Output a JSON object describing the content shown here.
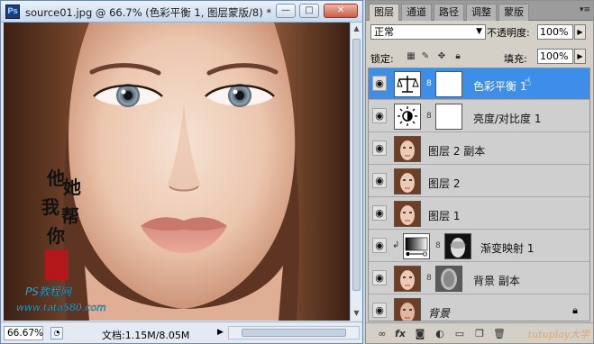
{
  "document": {
    "ps_logo": "Ps",
    "title": "source01.jpg @ 66.7% (色彩平衡 1, 图层蒙版/8) *",
    "buttons": {
      "minimize": "—",
      "restore": "□",
      "close": "✕"
    },
    "status": {
      "zoom": "66.67%",
      "info": "文档:1.15M/8.05M",
      "arrow": "▶"
    },
    "canvas_text": {
      "calligraphy": [
        "他",
        "她",
        "我",
        "帮",
        "你"
      ],
      "site_line1": "PS教程网",
      "site_line2": "www.tata580.com"
    }
  },
  "panel": {
    "tabs": [
      "图层",
      "通道",
      "路径",
      "调整",
      "蒙版"
    ],
    "active_tab": "图层",
    "menu_icon": "▾≡",
    "blend_mode": "正常",
    "opacity_label": "不透明度:",
    "opacity_value": "100%",
    "lock_label": "锁定:",
    "fill_label": "填充:",
    "fill_value": "100%",
    "lock_icons": [
      "transparent-pixels-lock-icon",
      "brush-lock-icon",
      "move-lock-icon",
      "all-lock-icon"
    ],
    "layers": [
      {
        "name": "色彩平衡 1",
        "type": "adjustment-color-balance",
        "selected": true,
        "visible": true
      },
      {
        "name": "亮度/对比度 1",
        "type": "adjustment-brightness",
        "selected": false,
        "visible": true
      },
      {
        "name": "图层 2 副本",
        "type": "pixel",
        "selected": false,
        "visible": true
      },
      {
        "name": "图层 2",
        "type": "pixel",
        "selected": false,
        "visible": true
      },
      {
        "name": "图层 1",
        "type": "pixel",
        "selected": false,
        "visible": true
      },
      {
        "name": "渐变映射 1",
        "type": "adjustment-gradient-map",
        "selected": false,
        "visible": true,
        "clipped": true
      },
      {
        "name": "背景 副本",
        "type": "pixel-masked",
        "selected": false,
        "visible": true
      },
      {
        "name": "背景",
        "type": "background",
        "selected": false,
        "visible": true,
        "locked": true
      }
    ],
    "bottom_icons": [
      "link-icon",
      "fx-icon",
      "add-mask-icon",
      "new-adjustment-icon",
      "new-group-icon",
      "new-layer-icon",
      "trash-icon"
    ],
    "watermark": "tutuplay大学"
  },
  "colors": {
    "selected_row": "#3d8ee8",
    "panel_bg": "#d4d0c8",
    "titlebar_top": "#e9f1fa"
  }
}
